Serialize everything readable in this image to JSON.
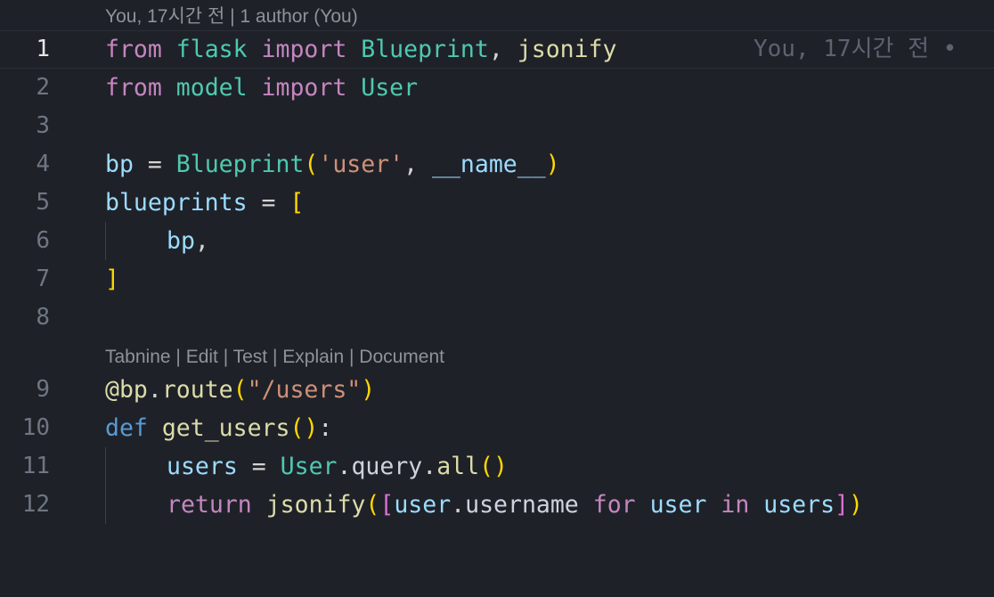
{
  "blame_lens": {
    "author": "You, 17시간 전",
    "sep": " | ",
    "authors": "1 author (You)"
  },
  "tabnine_lens": {
    "items": [
      "Tabnine",
      "Edit",
      "Test",
      "Explain",
      "Document"
    ],
    "sep": " | "
  },
  "inline_blame": "You, 17시간 전 • ",
  "line_numbers": [
    "1",
    "2",
    "3",
    "4",
    "5",
    "6",
    "7",
    "8",
    "9",
    "10",
    "11",
    "12"
  ],
  "active_line": "1",
  "code": {
    "l1": {
      "t1": "from",
      "t2": "flask",
      "t3": "import",
      "t4": "Blueprint",
      "t5": ",",
      "t6": "jsonify"
    },
    "l2": {
      "t1": "from",
      "t2": "model",
      "t3": "import",
      "t4": "User"
    },
    "l4": {
      "t1": "bp",
      "t2": " = ",
      "t3": "Blueprint",
      "t4": "(",
      "t5": "'user'",
      "t6": ", ",
      "t7": "__name__",
      "t8": ")"
    },
    "l5": {
      "t1": "blueprints",
      "t2": " = ",
      "t3": "["
    },
    "l6": {
      "t1": "bp",
      "t2": ","
    },
    "l7": {
      "t1": "]"
    },
    "l9": {
      "t1": "@bp",
      "t2": ".",
      "t3": "route",
      "t4": "(",
      "t5": "\"/users\"",
      "t6": ")"
    },
    "l10": {
      "t1": "def",
      "t2": "get_users",
      "t3": "()",
      "t4": ":"
    },
    "l11": {
      "t1": "users",
      "t2": " = ",
      "t3": "User",
      "t4": ".",
      "t5": "query",
      "t6": ".",
      "t7": "all",
      "t8": "()"
    },
    "l12": {
      "t1": "return",
      "t2": "jsonify",
      "t3": "(",
      "t4": "[",
      "t5": "user",
      "t6": ".",
      "t7": "username",
      "t8": "for",
      "t9": "user",
      "t10": "in",
      "t11": "users",
      "t12": "]",
      "t13": ")"
    }
  }
}
